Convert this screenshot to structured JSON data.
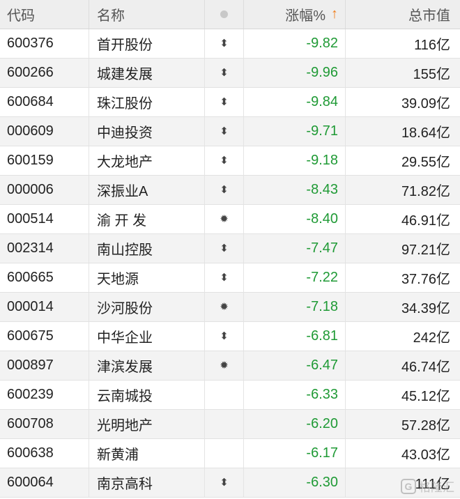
{
  "header": {
    "code_label": "代码",
    "name_label": "名称",
    "change_label": "涨幅%",
    "sort_icon": "arrow-up-icon",
    "cap_label": "总市值"
  },
  "colors": {
    "down": "#1f9a35",
    "sort_arrow": "#f07d1a"
  },
  "rows": [
    {
      "code": "600376",
      "name": "首开股份",
      "flag": "pin",
      "flag_glyph": "⬍",
      "change": "-9.82",
      "cap": "116亿"
    },
    {
      "code": "600266",
      "name": "城建发展",
      "flag": "pin",
      "flag_glyph": "⬍",
      "change": "-9.96",
      "cap": "155亿"
    },
    {
      "code": "600684",
      "name": "珠江股份",
      "flag": "pin",
      "flag_glyph": "⬍",
      "change": "-9.84",
      "cap": "39.09亿"
    },
    {
      "code": "000609",
      "name": "中迪投资",
      "flag": "pin",
      "flag_glyph": "⬍",
      "change": "-9.71",
      "cap": "18.64亿"
    },
    {
      "code": "600159",
      "name": "大龙地产",
      "flag": "pin",
      "flag_glyph": "⬍",
      "change": "-9.18",
      "cap": "29.55亿"
    },
    {
      "code": "000006",
      "name": "深振业A",
      "flag": "pin",
      "flag_glyph": "⬍",
      "change": "-8.43",
      "cap": "71.82亿"
    },
    {
      "code": "000514",
      "name": "渝 开 发",
      "flag": "star",
      "flag_glyph": "✹",
      "change": "-8.40",
      "cap": "46.91亿"
    },
    {
      "code": "002314",
      "name": "南山控股",
      "flag": "pin",
      "flag_glyph": "⬍",
      "change": "-7.47",
      "cap": "97.21亿"
    },
    {
      "code": "600665",
      "name": "天地源",
      "flag": "pin",
      "flag_glyph": "⬍",
      "change": "-7.22",
      "cap": "37.76亿"
    },
    {
      "code": "000014",
      "name": "沙河股份",
      "flag": "star",
      "flag_glyph": "✹",
      "change": "-7.18",
      "cap": "34.39亿"
    },
    {
      "code": "600675",
      "name": "中华企业",
      "flag": "pin",
      "flag_glyph": "⬍",
      "change": "-6.81",
      "cap": "242亿"
    },
    {
      "code": "000897",
      "name": "津滨发展",
      "flag": "star",
      "flag_glyph": "✹",
      "change": "-6.47",
      "cap": "46.74亿"
    },
    {
      "code": "600239",
      "name": "云南城投",
      "flag": "",
      "flag_glyph": "",
      "change": "-6.33",
      "cap": "45.12亿"
    },
    {
      "code": "600708",
      "name": "光明地产",
      "flag": "",
      "flag_glyph": "",
      "change": "-6.20",
      "cap": "57.28亿"
    },
    {
      "code": "600638",
      "name": "新黄浦",
      "flag": "",
      "flag_glyph": "",
      "change": "-6.17",
      "cap": "43.03亿"
    },
    {
      "code": "600064",
      "name": "南京高科",
      "flag": "pin",
      "flag_glyph": "⬍",
      "change": "-6.30",
      "cap": "111亿"
    }
  ],
  "watermark": {
    "logo_letter": "G",
    "text": "格隆汇"
  }
}
